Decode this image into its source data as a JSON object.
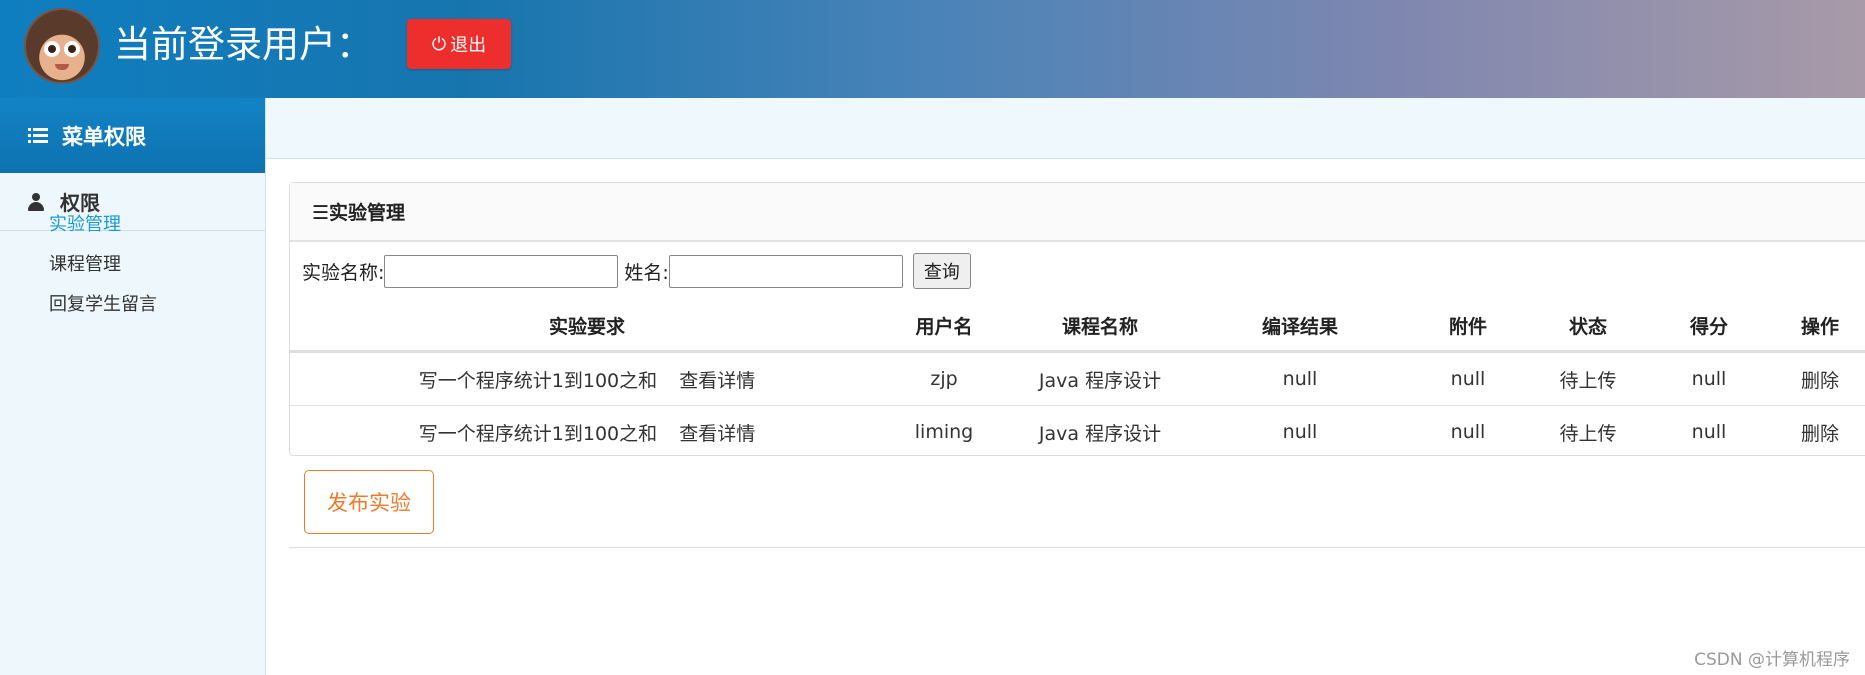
{
  "header": {
    "title": "当前登录用户：",
    "logout_label": "退出",
    "logout_icon": "power-icon"
  },
  "sidebar": {
    "menu_title": "菜单权限",
    "group_title": "权限",
    "items": [
      {
        "label": "实验管理",
        "active": true
      },
      {
        "label": "课程管理",
        "active": false
      },
      {
        "label": "回复学生留言",
        "active": false
      }
    ]
  },
  "panel": {
    "title": "☰实验管理",
    "search": {
      "name_label": "实验名称:",
      "name_value": "",
      "student_label": "姓名:",
      "student_value": "",
      "query_label": "查询"
    },
    "table": {
      "columns": [
        "实验要求",
        "用户名",
        "课程名称",
        "编译结果",
        "附件",
        "状态",
        "得分",
        "操作"
      ],
      "rows": [
        {
          "requirement": "写一个程序统计1到100之和",
          "detail": "查看详情",
          "username": "zjp",
          "course": "Java 程序设计",
          "compile": "null",
          "attachment": "null",
          "status": "待上传",
          "score": "null",
          "action": "删除"
        },
        {
          "requirement": "写一个程序统计1到100之和",
          "detail": "查看详情",
          "username": "liming",
          "course": "Java 程序设计",
          "compile": "null",
          "attachment": "null",
          "status": "待上传",
          "score": "null",
          "action": "删除"
        }
      ]
    },
    "publish_label": "发布实验"
  },
  "watermark": "CSDN @计算机程序",
  "colors": {
    "accent": "#1383c6",
    "danger": "#ee2d2d",
    "orange": "#f07a2a",
    "active_link": "#1a9ad6"
  }
}
